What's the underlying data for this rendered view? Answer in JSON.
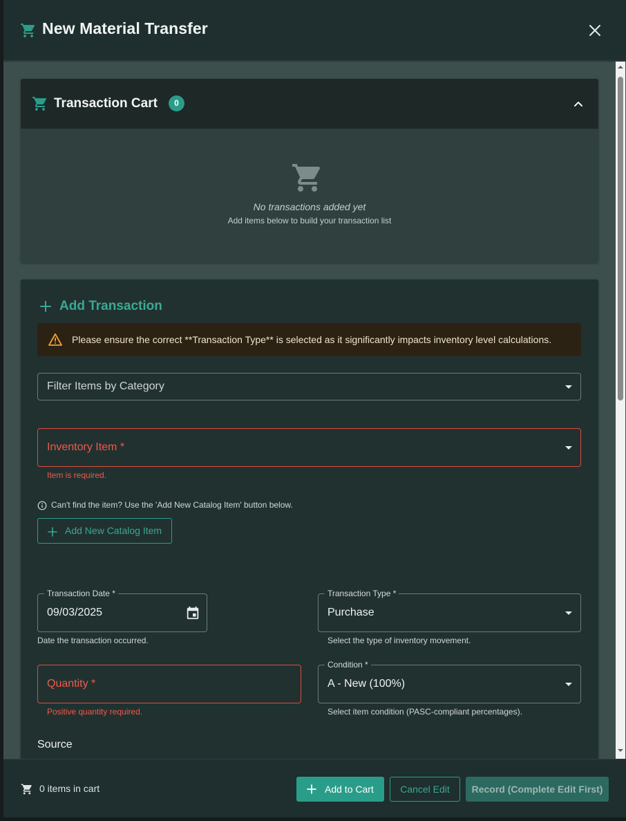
{
  "dialog": {
    "title": "New Material Transfer",
    "close_icon": "close-icon"
  },
  "cart": {
    "title": "Transaction Cart",
    "count": "0",
    "empty_title": "No transactions added yet",
    "empty_subtitle": "Add items below to build your transaction list"
  },
  "transaction": {
    "title": "Add Transaction",
    "alert": "Please ensure the correct **Transaction Type** is selected as it significantly impacts inventory level calculations.",
    "category_filter": {
      "label": "Filter Items by Category"
    },
    "inventory_item": {
      "label": "Inventory Item *",
      "error": "Item is required."
    },
    "info_text": "Can't find the item? Use the 'Add New Catalog Item' button below.",
    "add_catalog_button": "Add New Catalog Item",
    "transaction_date": {
      "label": "Transaction Date *",
      "value": "09/03/2025",
      "helper": "Date the transaction occurred."
    },
    "transaction_type": {
      "label": "Transaction Type *",
      "value": "Purchase",
      "helper": "Select the type of inventory movement."
    },
    "quantity": {
      "label": "Quantity *",
      "error": "Positive quantity required."
    },
    "condition": {
      "label": "Condition *",
      "value": "A - New (100%)",
      "helper": "Select item condition (PASC-compliant percentages)."
    },
    "source_label": "Source"
  },
  "footer": {
    "cart_count": "0 items in cart",
    "add_to_cart": "Add to Cart",
    "cancel_edit": "Cancel Edit",
    "record": "Record (Complete Edit First)"
  },
  "colors": {
    "accent": "#2a9d8a",
    "error": "#ef5a4b",
    "warning": "#f0a13a"
  }
}
